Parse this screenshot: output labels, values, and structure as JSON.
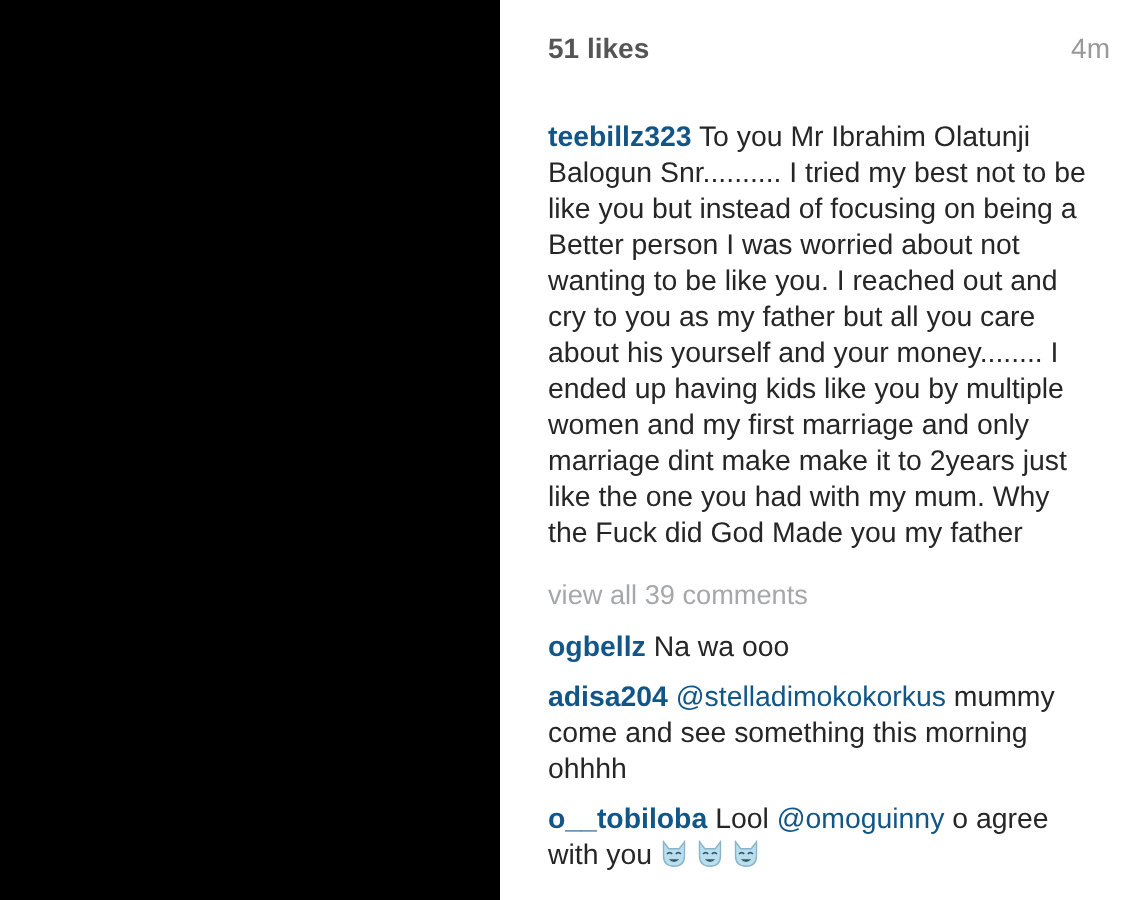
{
  "likes": "51 likes",
  "time": "4m",
  "caption": {
    "user": "teebillz323",
    "parts": [
      {
        "kind": "text",
        "text": "To you Mr Ibrahim Olatunji Balogun Snr.......... I tried my best not to be like you but instead of focusing on being a Better person I was worried about not wanting to be like you. I reached out and cry to you as my father but all you care about his yourself and your money........ I ended up having kids like you by multiple women and my first marriage and only marriage dint make make it to 2years just like the one you had with my mum. Why the Fuck did God Made you my father"
      }
    ]
  },
  "view_all": "view all 39 comments",
  "comments": [
    {
      "user": "ogbellz",
      "parts": [
        {
          "kind": "text",
          "text": "Na wa ooo"
        }
      ]
    },
    {
      "user": "adisa204",
      "parts": [
        {
          "kind": "mention",
          "text": "@stelladimokokorkus"
        },
        {
          "kind": "text",
          "text": "mummy come and see something this morning ohhhh"
        }
      ]
    },
    {
      "user": "o__tobiloba",
      "parts": [
        {
          "kind": "text",
          "text": "Lool"
        },
        {
          "kind": "mention",
          "text": "@omoguinny"
        },
        {
          "kind": "text",
          "text": "o agree with you"
        },
        {
          "kind": "emoji"
        },
        {
          "kind": "emoji"
        },
        {
          "kind": "emoji"
        }
      ]
    }
  ]
}
